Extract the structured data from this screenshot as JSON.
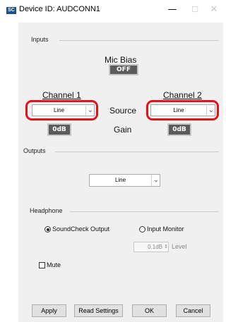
{
  "window": {
    "icon_text": "SC",
    "title": "Device ID: AUDCONN1",
    "minimize_glyph": "—",
    "maximize_glyph": "☐",
    "close_glyph": "✕"
  },
  "inputs": {
    "section_label": "Inputs",
    "mic_bias_label": "Mic Bias",
    "mic_bias_value": "OFF",
    "channel1_label": "Channel 1",
    "channel2_label": "Channel 2",
    "channel1_source": "Line",
    "channel2_source": "Line",
    "source_label": "Source",
    "gain_label": "Gain",
    "channel1_gain": "0dB",
    "channel2_gain": "0dB"
  },
  "outputs": {
    "section_label": "Outputs",
    "value": "Line"
  },
  "headphone": {
    "section_label": "Headphone",
    "option1": "SoundCheck Output",
    "option2": "Input Monitor",
    "selected_option": "SoundCheck Output",
    "level_value": "0.1dB",
    "level_label": "Level",
    "mute_label": "Mute",
    "mute_checked": false
  },
  "buttons": {
    "apply": "Apply",
    "read_settings": "Read Settings",
    "ok": "OK",
    "cancel": "Cancel"
  },
  "colors": {
    "highlight": "#e0141b",
    "dark_button": "#5b5b5b",
    "panel_bg": "#f0f0f0"
  }
}
